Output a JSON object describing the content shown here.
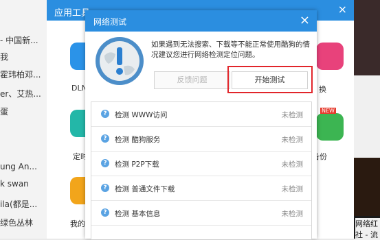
{
  "background_list": {
    "items": [
      "- 中国新...",
      "我",
      "霍玮柏邓...",
      "er、艾热...",
      "蛋",
      "ung An...",
      "k swan",
      "ila(都是...",
      "绿色丛林"
    ]
  },
  "tool_panel": {
    "title": "应用工具",
    "close": "×",
    "labels": [
      "DLN",
      "定时",
      "我的",
      "换",
      "备份",
      "NEW"
    ]
  },
  "right_panel": {
    "captions": [
      "网络红",
      "社 - 流"
    ]
  },
  "dialog": {
    "title": "网络测试",
    "close": "×",
    "description": "如果遇到无法搜索、下载等不能正常使用酷狗的情况建议您进行网络检测定位问题。",
    "feedback_button": "反馈问题",
    "start_button": "开始测试",
    "checks": [
      {
        "label": "检测 WWW访问",
        "status": "未检测"
      },
      {
        "label": "检测 酷狗服务",
        "status": "未检测"
      },
      {
        "label": "检测 P2P下载",
        "status": "未检测"
      },
      {
        "label": "检测 普通文件下载",
        "status": "未检测"
      },
      {
        "label": "检测 基本信息",
        "status": "未检测"
      }
    ]
  }
}
